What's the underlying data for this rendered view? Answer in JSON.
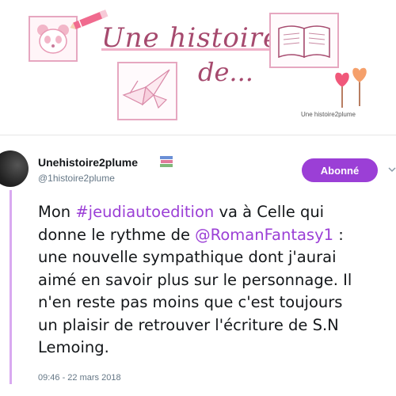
{
  "banner": {
    "title_line1": "Une histoire",
    "title_line2": "de...",
    "caption": "Une histoire2plume"
  },
  "tweet": {
    "display_name": "Unehistoire2plume",
    "handle": "@1histoire2plume",
    "follow_label": "Abonné",
    "text": {
      "l1_a": "Mon ",
      "l1_hashtag": "#jeudiautoedition",
      "l1_b": " va à Celle qui",
      "l2_a": "donne le rythme de ",
      "l2_mention": "@RomanFantasy1",
      "l2_b": " :",
      "l3": "une nouvelle sympathique dont j'aurai",
      "l4": "aimé en savoir plus sur le personnage. Il",
      "l5": "n'en reste pas moins que c'est toujours",
      "l6": "un plaisir de retrouver l'écriture de S.N",
      "l7": "Lemoing."
    },
    "timestamp": "09:46 - 22 mars 2018"
  },
  "colors": {
    "accent": "#9b3fd6",
    "thread_line": "#d9a9f0",
    "banner_pink": "#e6a7c0",
    "banner_title": "#a64a6e"
  },
  "icons": {
    "books": "books-icon",
    "chevron": "chevron-down-icon",
    "panda": "panda-icon",
    "pencil": "pencil-icon",
    "crane": "origami-crane-icon",
    "book": "open-book-icon",
    "lollipops": "lollipop-icon"
  }
}
